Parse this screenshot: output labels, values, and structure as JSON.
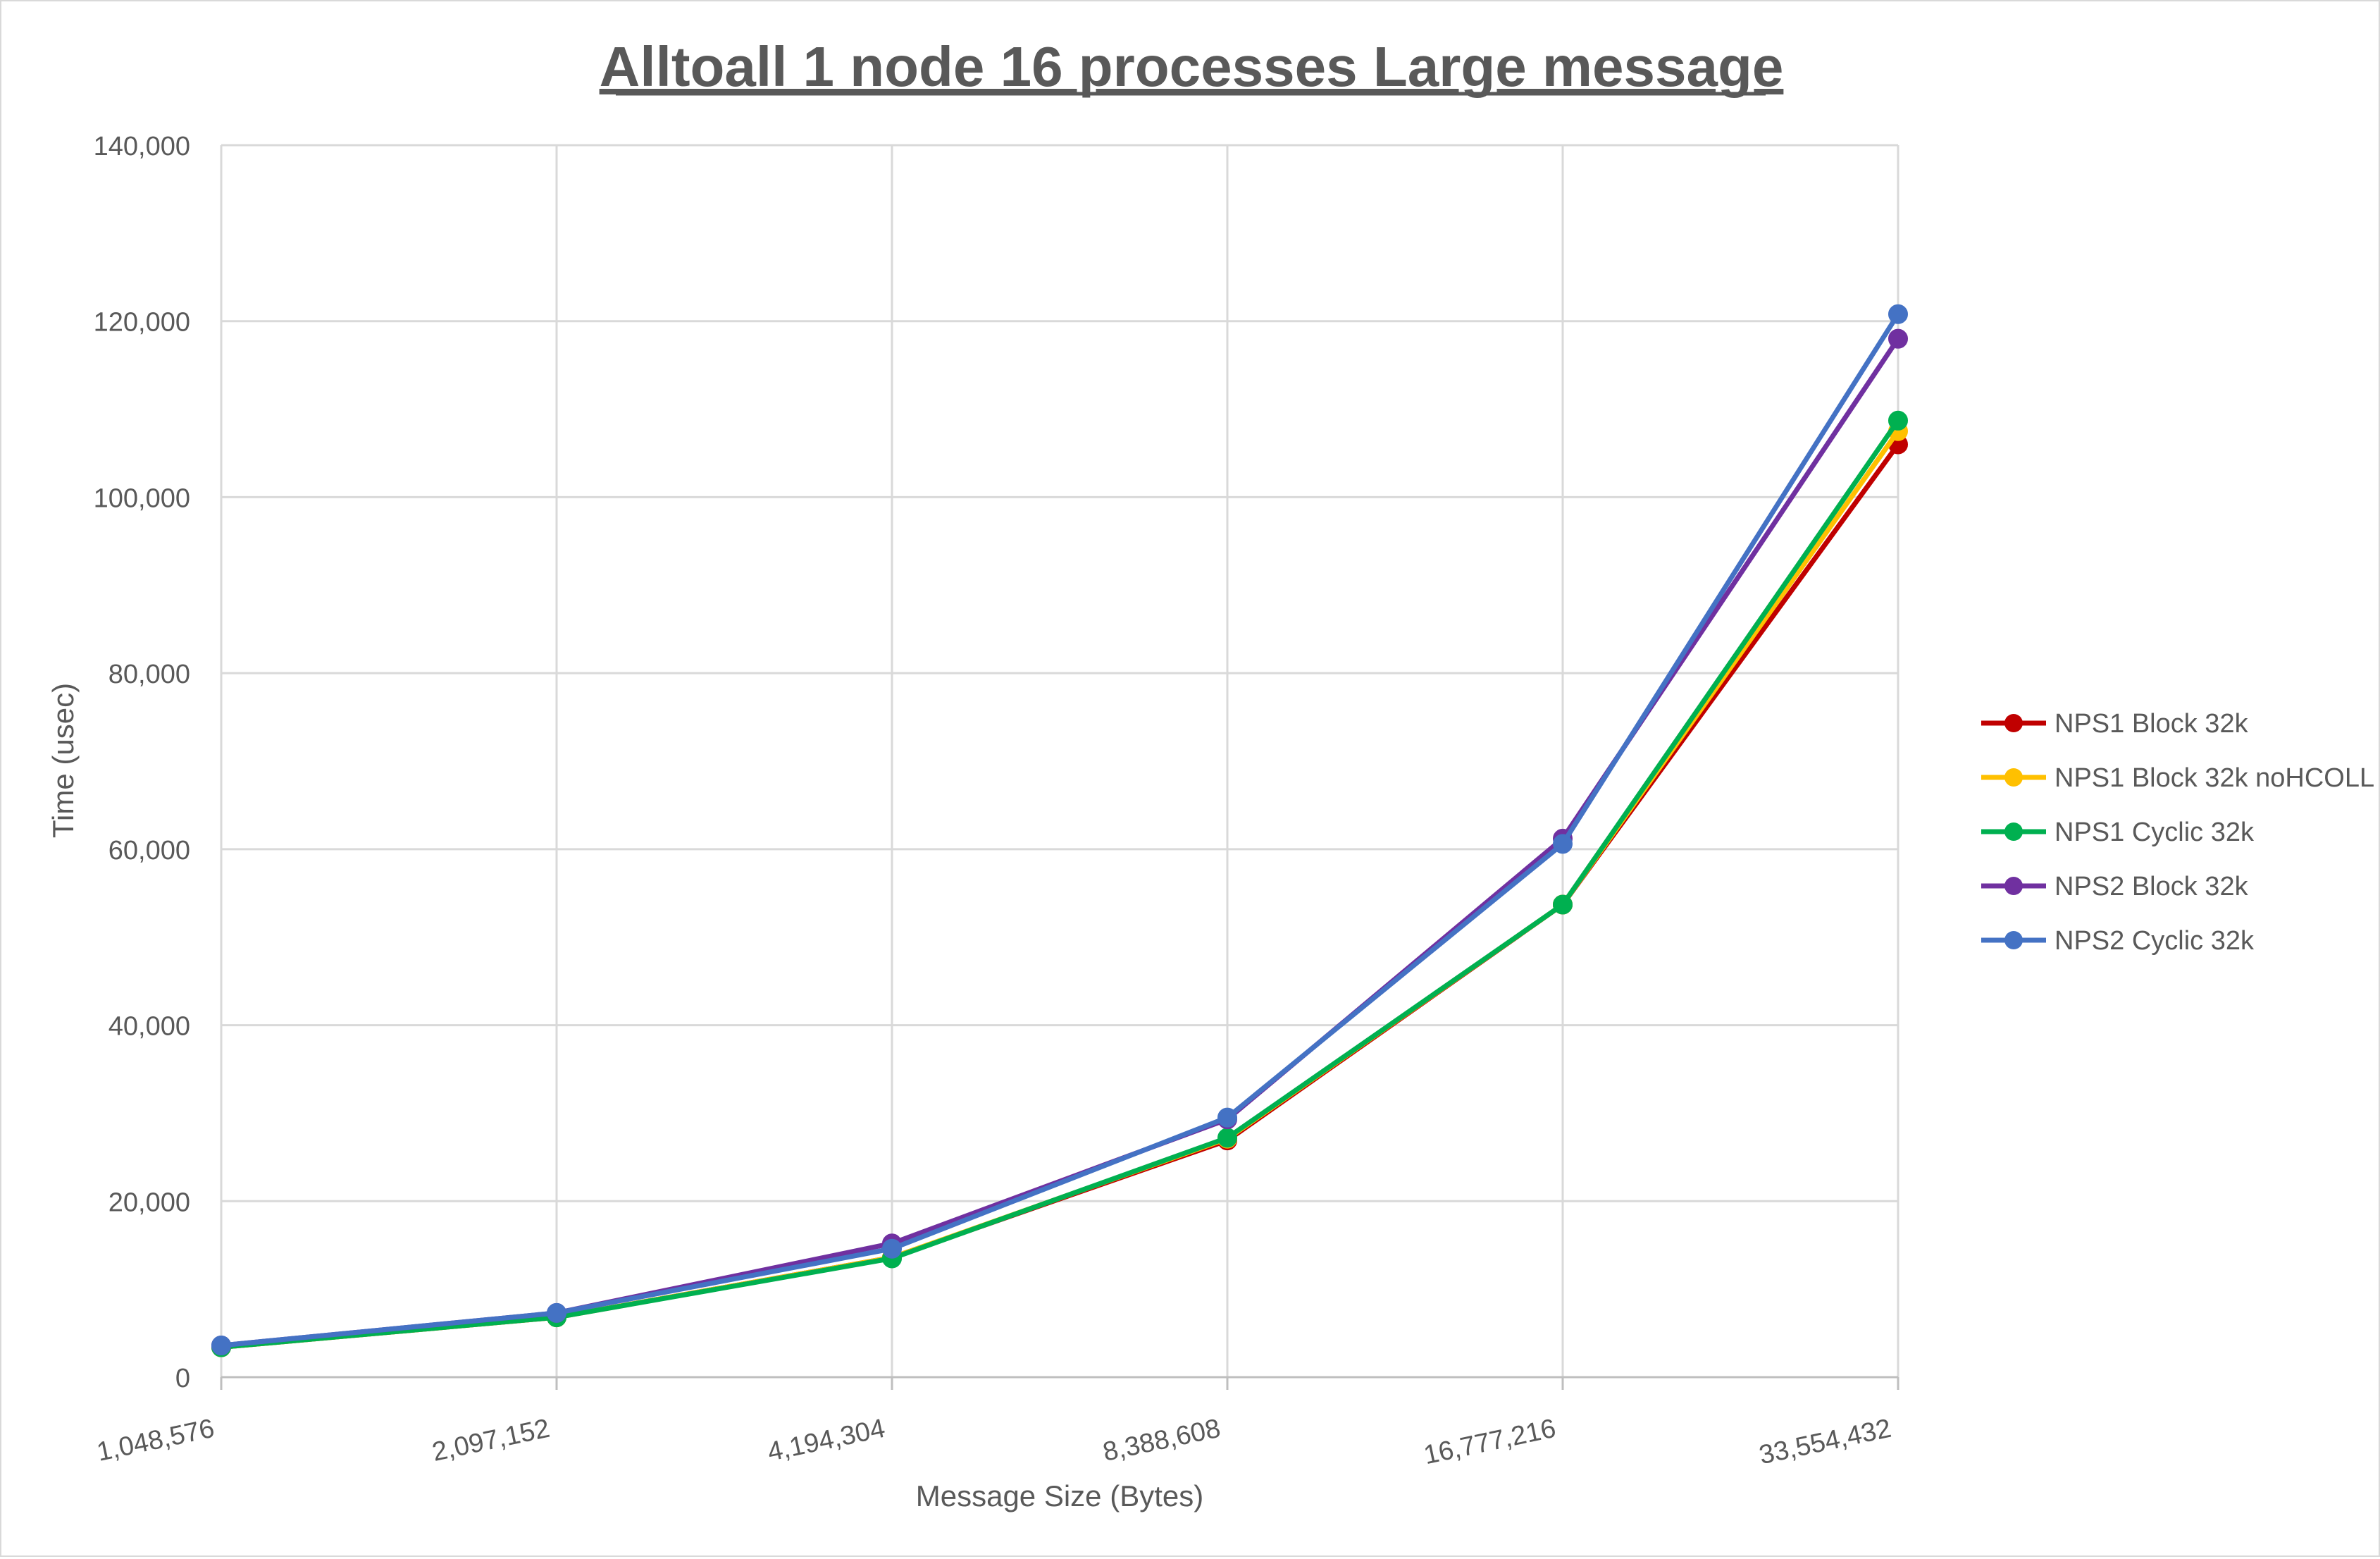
{
  "chart_data": {
    "type": "line",
    "title": "Alltoall 1 node 16 processes Large message",
    "xlabel": "Message Size (Bytes)",
    "ylabel": "Time (usec)",
    "categories": [
      "1,048,576",
      "2,097,152",
      "4,194,304",
      "8,388,608",
      "16,777,216",
      "33,554,432"
    ],
    "ylim": [
      0,
      140000
    ],
    "yticks": [
      0,
      20000,
      40000,
      60000,
      80000,
      100000,
      120000,
      140000
    ],
    "ytick_labels": [
      "0",
      "20,000",
      "40,000",
      "60,000",
      "80,000",
      "100,000",
      "120,000",
      "140,000"
    ],
    "grid": true,
    "legend_position": "right",
    "series": [
      {
        "name": "NPS1 Block 32k",
        "color": "#c00000",
        "values": [
          3400,
          6800,
          13600,
          26900,
          53700,
          106000
        ]
      },
      {
        "name": "NPS1 Block 32k noHCOLL",
        "color": "#ffc000",
        "values": [
          3400,
          6800,
          13600,
          27100,
          53700,
          107500
        ]
      },
      {
        "name": "NPS1 Cyclic 32k",
        "color": "#00b050",
        "values": [
          3400,
          6800,
          13500,
          27200,
          53700,
          108700
        ]
      },
      {
        "name": "NPS2 Block 32k",
        "color": "#7030a0",
        "values": [
          3600,
          7300,
          15200,
          29300,
          61200,
          118000
        ]
      },
      {
        "name": "NPS2 Cyclic 32k",
        "color": "#4472c4",
        "values": [
          3600,
          7300,
          14600,
          29500,
          60600,
          120800
        ]
      }
    ]
  }
}
